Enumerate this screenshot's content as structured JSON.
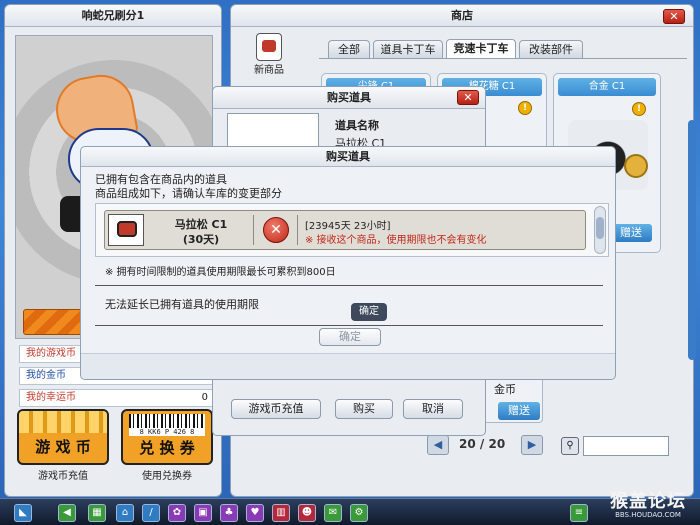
{
  "left_panel": {
    "title": "响蛇兄刷分1",
    "currencies": [
      {
        "label": "我的游戏币",
        "value": "",
        "color": "#c0392b"
      },
      {
        "label": "我的金币",
        "value": "",
        "color": "#1f4fa8"
      },
      {
        "label": "我的幸运币",
        "value": "0",
        "color": "#c0392b"
      }
    ],
    "recharge_label": "游 戏 币",
    "recharge_caption": "游戏币充值",
    "coupon_label": "兑 换 券",
    "coupon_barcode": "8 KK6 P 426 8",
    "coupon_caption": "使用兑换券"
  },
  "shop": {
    "title": "商店",
    "close": "✕",
    "new_label": "新商品",
    "tabs": [
      "全部",
      "道具卡丁车",
      "竞速卡丁车",
      "改装部件"
    ],
    "active_tab": 2,
    "cards": [
      {
        "name": "尖锋 C1"
      },
      {
        "name": "棉花糖 C1"
      },
      {
        "name": "合金 C1"
      }
    ],
    "gift_label": "赠送",
    "coin_label": "金币",
    "page_current": "20",
    "page_sep": "/",
    "page_total": "20",
    "prev_icon": "◀",
    "next_icon": "▶",
    "search_icon": "🔍",
    "search_value": ""
  },
  "buy_dialog": {
    "title": "购买道具",
    "close": "✕",
    "item_name_header": "道具名称",
    "item_name": "马拉松 C1",
    "recharge_button": "游戏币充值",
    "buy_button": "购买",
    "cancel_button": "取消"
  },
  "confirm_dialog": {
    "title": "购买道具",
    "line1": "已拥有包含在商品内的道具",
    "line2": "商品组成如下，请确认车库的变更部分",
    "item_name": "马拉松 C1",
    "item_duration": "(30天)",
    "remaining": "[23945天 23小时]",
    "warning": "※ 接收这个商品，使用期限也不会有变化",
    "note": "※ 拥有时间限制的道具使用期限最长可累积到800日",
    "message": "无法延长已拥有道具的使用期限",
    "tooltip": "确定",
    "ok_button": "确定"
  },
  "watermark": {
    "text": "猴盖论坛",
    "url": "BBS.HOUDAO.COM"
  }
}
